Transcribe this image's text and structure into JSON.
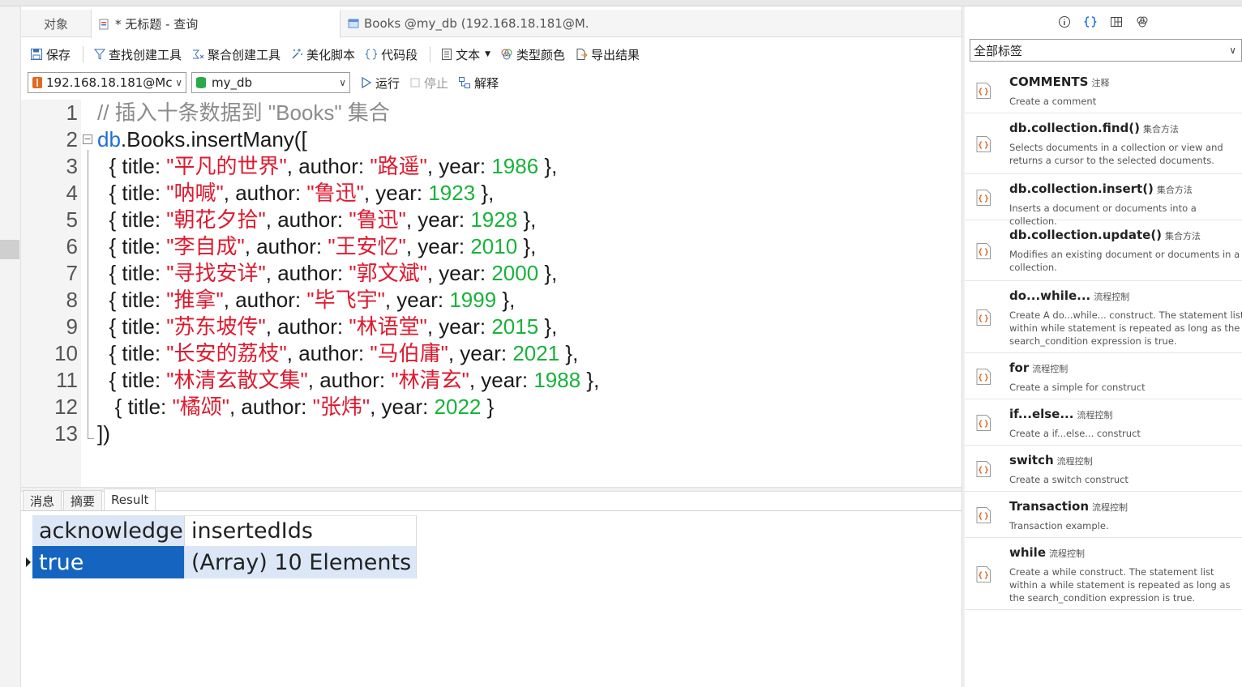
{
  "tabs": {
    "objects": "对象",
    "active": "* 无标题 - 查询",
    "third": "Books @my_db (192.168.18.181@M..."
  },
  "toolbar": {
    "save": "保存",
    "find_builder": "查找创建工具",
    "agg_builder": "聚合创建工具",
    "beautify": "美化脚本",
    "snippet": "代码段",
    "text": "文本",
    "type_color": "类型颜色",
    "export": "导出结果"
  },
  "toolbar2": {
    "connection": "192.168.18.181@Mc",
    "database": "my_db",
    "run": "运行",
    "stop": "停止",
    "explain": "解释"
  },
  "editor": {
    "line_numbers": [
      "1",
      "2",
      "3",
      "4",
      "5",
      "6",
      "7",
      "8",
      "9",
      "10",
      "11",
      "12",
      "13"
    ],
    "comment": "// 插入十条数据到 \"Books\" 集合",
    "call_db": "db",
    "call_rest": ".Books.insertMany([",
    "closing": "])",
    "docs": [
      {
        "indent": "  ",
        "title": "\"平凡的世界\"",
        "author": "\"路遥\"",
        "year": "1986",
        "tail": " },"
      },
      {
        "indent": "  ",
        "title": "\"呐喊\"",
        "author": "\"鲁迅\"",
        "year": "1923",
        "tail": " },"
      },
      {
        "indent": "  ",
        "title": "\"朝花夕拾\"",
        "author": "\"鲁迅\"",
        "year": "1928",
        "tail": " },"
      },
      {
        "indent": "  ",
        "title": "\"李自成\"",
        "author": "\"王安忆\"",
        "year": "2010",
        "tail": " },"
      },
      {
        "indent": "  ",
        "title": "\"寻找安详\"",
        "author": "\"郭文斌\"",
        "year": "2000",
        "tail": " },"
      },
      {
        "indent": "  ",
        "title": "\"推拿\"",
        "author": "\"毕飞宇\"",
        "year": "1999",
        "tail": " },"
      },
      {
        "indent": "  ",
        "title": "\"苏东坡传\"",
        "author": "\"林语堂\"",
        "year": "2015",
        "tail": " },"
      },
      {
        "indent": "  ",
        "title": "\"长安的荔枝\"",
        "author": "\"马伯庸\"",
        "year": "2021",
        "tail": " },"
      },
      {
        "indent": "  ",
        "title": "\"林清玄散文集\"",
        "author": "\"林清玄\"",
        "year": "1988",
        "tail": " },"
      },
      {
        "indent": "   ",
        "title": "\"橘颂\"",
        "author": "\"张炜\"",
        "year": "2022",
        "tail": " }"
      }
    ],
    "kw_open": "{ title: ",
    "kw_author": ", author: ",
    "kw_year": ", year: "
  },
  "result_tabs": {
    "messages": "消息",
    "summary": "摘要",
    "result": "Result"
  },
  "grid": {
    "headers": [
      "acknowledged",
      "insertedIds"
    ],
    "row": [
      "true",
      "(Array) 10 Elements"
    ]
  },
  "sidebar": {
    "filter": "全部标签",
    "snippets": [
      {
        "title": "COMMENTS",
        "tag": "注释",
        "desc": "Create a comment"
      },
      {
        "title": "db.collection.find()",
        "tag": "集合方法",
        "desc": "Selects documents in a collection or view and returns a cursor to the selected documents."
      },
      {
        "title": "db.collection.insert()",
        "tag": "集合方法",
        "desc": "Inserts a document or documents into a collection."
      },
      {
        "title": "db.collection.update()",
        "tag": "集合方法",
        "desc": "Modifies an existing document or documents in a collection."
      },
      {
        "title": "do...while...",
        "tag": "流程控制",
        "desc": "Create A do...while... construct. The statement list within while statement is repeated as long as the search_condition expression is true."
      },
      {
        "title": "for",
        "tag": "流程控制",
        "desc": "Create a simple for construct"
      },
      {
        "title": "if...else...",
        "tag": "流程控制",
        "desc": "Create a if...else... construct"
      },
      {
        "title": "switch",
        "tag": "流程控制",
        "desc": "Create a switch construct"
      },
      {
        "title": "Transaction",
        "tag": "流程控制",
        "desc": "Transaction example."
      },
      {
        "title": "while",
        "tag": "流程控制",
        "desc": "Create a while construct. The statement list within a while statement is repeated as long as the search_condition expression is true."
      }
    ]
  },
  "colors": {
    "keyword": "#1e6fd9",
    "string": "#e0192e",
    "number": "#19b23b",
    "comment": "#8c8c8c",
    "selection": "#1565c0",
    "header_bg": "#dbe7f6"
  },
  "icons": {
    "save": "save-icon",
    "find": "funnel-icon",
    "aggregate": "aggregate-icon",
    "beautify": "sparkle-icon",
    "snippet": "braces-icon",
    "text": "document-icon",
    "type_color": "palette-icon",
    "export": "export-icon",
    "run": "play-icon",
    "stop": "stop-icon",
    "explain": "explain-icon",
    "snippet_item": "snippet-icon"
  }
}
